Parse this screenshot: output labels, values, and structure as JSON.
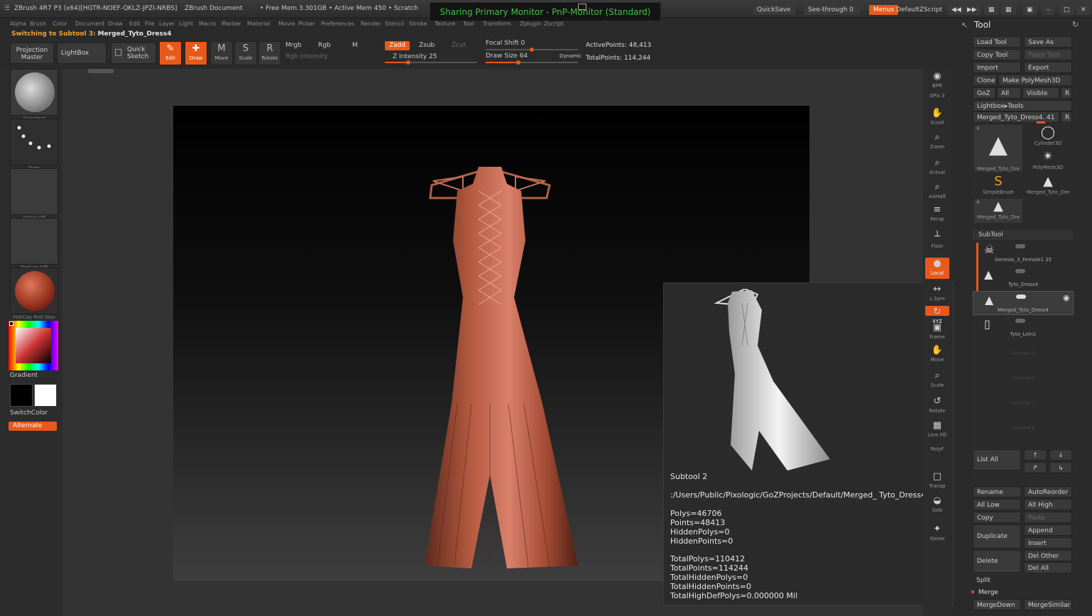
{
  "window": {
    "title": "ZBrush 4R7 P3 (x64)[HGTR-NOEF-QKLZ-JPZI-NRBS]",
    "doc": "ZBrush Document",
    "mem": "• Free Mem 3.301GB • Active Mem 450 • Scratch",
    "share": "Sharing Primary Monitor - PnP-Monitor (Standard)",
    "quicksave": "QuickSave",
    "seethrough": "See-through",
    "seethrough_val": "0",
    "menus": "Menus",
    "script": "DefaultZScript"
  },
  "menubar": [
    "Alpha",
    "Brush",
    "Color",
    "Document",
    "Draw",
    "Edit",
    "File",
    "Layer",
    "Light",
    "Macro",
    "Marker",
    "Material",
    "Movie",
    "Picker",
    "Preferences",
    "Render",
    "Stencil",
    "Stroke",
    "Texture",
    "Tool",
    "Transform",
    "Zplugin",
    "Zscript"
  ],
  "notice": {
    "prefix": "Switching to Subtool 3:",
    "name": "Merged_Tyto_Dress4"
  },
  "toolbar": {
    "projection_master": "Projection Master",
    "lightbox": "LightBox",
    "quick_sketch": "Quick Sketch",
    "edit": "Edit",
    "draw": "Draw",
    "move": "Move",
    "scale": "Scale",
    "rotate": "Rotate",
    "mrgb": "Mrgb",
    "rgb": "Rgb",
    "m": "M",
    "rgb_intensity": "Rgb Intensity",
    "zadd": "Zadd",
    "zsub": "Zsub",
    "zcut": "Zcut",
    "z_intensity": "Z Intensity 25",
    "focal_shift": "Focal Shift 0",
    "draw_size": "Draw Size 64",
    "dynamic": "Dynamic",
    "active_points": "ActivePoints: 48,413",
    "total_points": "TotalPoints: 114,244",
    "z_intensity_level": 0.25,
    "draw_size_level": 0.35
  },
  "leftshelf": {
    "brush": "Standard",
    "stroke": "Dots",
    "alpha": "Alpha Off",
    "texture": "Texture Off",
    "material": "MatCap Red Wax",
    "gradient": "Gradient",
    "switchcolor": "SwitchColor",
    "alternate": "Alternate",
    "colors": {
      "primary": "#000000",
      "secondary": "#ffffff",
      "material": "#9a3a22"
    }
  },
  "rightshelf": [
    {
      "id": "bpr",
      "label": "BPR",
      "icon": "bpr-icon"
    },
    {
      "id": "spix",
      "label": "SPix 3",
      "icon": "spix-icon"
    },
    {
      "id": "scroll",
      "label": "Scroll",
      "icon": "scroll-icon"
    },
    {
      "id": "zoom",
      "label": "Zoom",
      "icon": "zoom-icon"
    },
    {
      "id": "actual",
      "label": "Actual",
      "icon": "actual-icon"
    },
    {
      "id": "aahalf",
      "label": "AAHalf",
      "icon": "aahalf-icon"
    },
    {
      "id": "persp",
      "label": "Persp",
      "icon": "persp-icon"
    },
    {
      "id": "floor",
      "label": "Floor",
      "icon": "floor-icon"
    },
    {
      "id": "local",
      "label": "Local",
      "icon": "local-icon"
    },
    {
      "id": "lsym",
      "label": "L.Sym",
      "icon": "lsym-icon"
    },
    {
      "id": "xyz",
      "label": "XYZ",
      "icon": "xyz-icon"
    },
    {
      "id": "frame",
      "label": "Frame",
      "icon": "frame-icon"
    },
    {
      "id": "move",
      "label": "Move",
      "icon": "move-icon"
    },
    {
      "id": "scale",
      "label": "Scale",
      "icon": "scale-icon"
    },
    {
      "id": "rotate",
      "label": "Rotate",
      "icon": "rotate-icon"
    },
    {
      "id": "linefill",
      "label": "Line Fill",
      "icon": "linefill-icon"
    },
    {
      "id": "polyf",
      "label": "PolyF",
      "icon": "polyf-icon"
    },
    {
      "id": "transp",
      "label": "Transp",
      "icon": "transp-icon"
    },
    {
      "id": "solo",
      "label": "Solo",
      "icon": "solo-icon"
    },
    {
      "id": "xpose",
      "label": "Xpose",
      "icon": "xpose-icon"
    }
  ],
  "toolpanel": {
    "title": "Tool",
    "load_tool": "Load Tool",
    "save_as": "Save As",
    "copy_tool": "Copy Tool",
    "paste_tool": "Paste Tool",
    "import": "Import",
    "export": "Export",
    "clone": "Clone",
    "make_polymesh": "Make PolyMesh3D",
    "goz": "GoZ",
    "all": "All",
    "visible": "Visible",
    "r": "R",
    "lightbox_tools": "Lightbox▸Tools",
    "current_tool": "Merged_Tyto_Dress4. 41",
    "thumbs": [
      {
        "label": "Merged_Tyto_Dre",
        "count": "4"
      },
      {
        "label": "Cylinder3D"
      },
      {
        "label": "PolyMesh3D"
      },
      {
        "label": "SimpleBrush"
      },
      {
        "label": "Merged_Tyto_Dre"
      },
      {
        "label": "Merged_Tyto_Dre",
        "count": "4"
      }
    ],
    "subtool_header": "SubTool",
    "subtools": [
      {
        "name": "Genesis_3_Female1 35"
      },
      {
        "name": "Tyto_Dress4"
      },
      {
        "name": "Merged_Tyto_Dress4"
      },
      {
        "name": "Tyto_Loin1"
      },
      {
        "name": "Unused 5"
      },
      {
        "name": "Unused 6"
      },
      {
        "name": "Unused 7"
      },
      {
        "name": "Unused 8"
      }
    ],
    "list_all": "List All",
    "rename": "Rename",
    "autoreorder": "AutoReorder",
    "all_low": "All Low",
    "all_high": "All High",
    "copy": "Copy",
    "paste": "Paste",
    "duplicate": "Duplicate",
    "append": "Append",
    "insert": "Insert",
    "delete": "Delete",
    "del_other": "Del Other",
    "del_all": "Del All",
    "split": "Split",
    "merge": "Merge",
    "merge_down": "MergeDown",
    "merge_similar": "MergeSimilar"
  },
  "popup": {
    "title": "Subtool 2",
    "path": ":/Users/Public/Pixologic/GoZProjects/Default/Merged_ Tyto_Dress4",
    "polys": "Polys=46706",
    "points": "Points=48413",
    "hidden_polys": "HiddenPolys=0",
    "hidden_points": "HiddenPoints=0",
    "total_polys": "TotalPolys=110412",
    "total_points": "TotalPoints=114244",
    "total_hidden_polys": "TotalHiddenPolys=0",
    "total_hidden_points": "TotalHiddenPoints=0",
    "total_highdef": "TotalHighDefPolys=0.000000 Mil"
  }
}
